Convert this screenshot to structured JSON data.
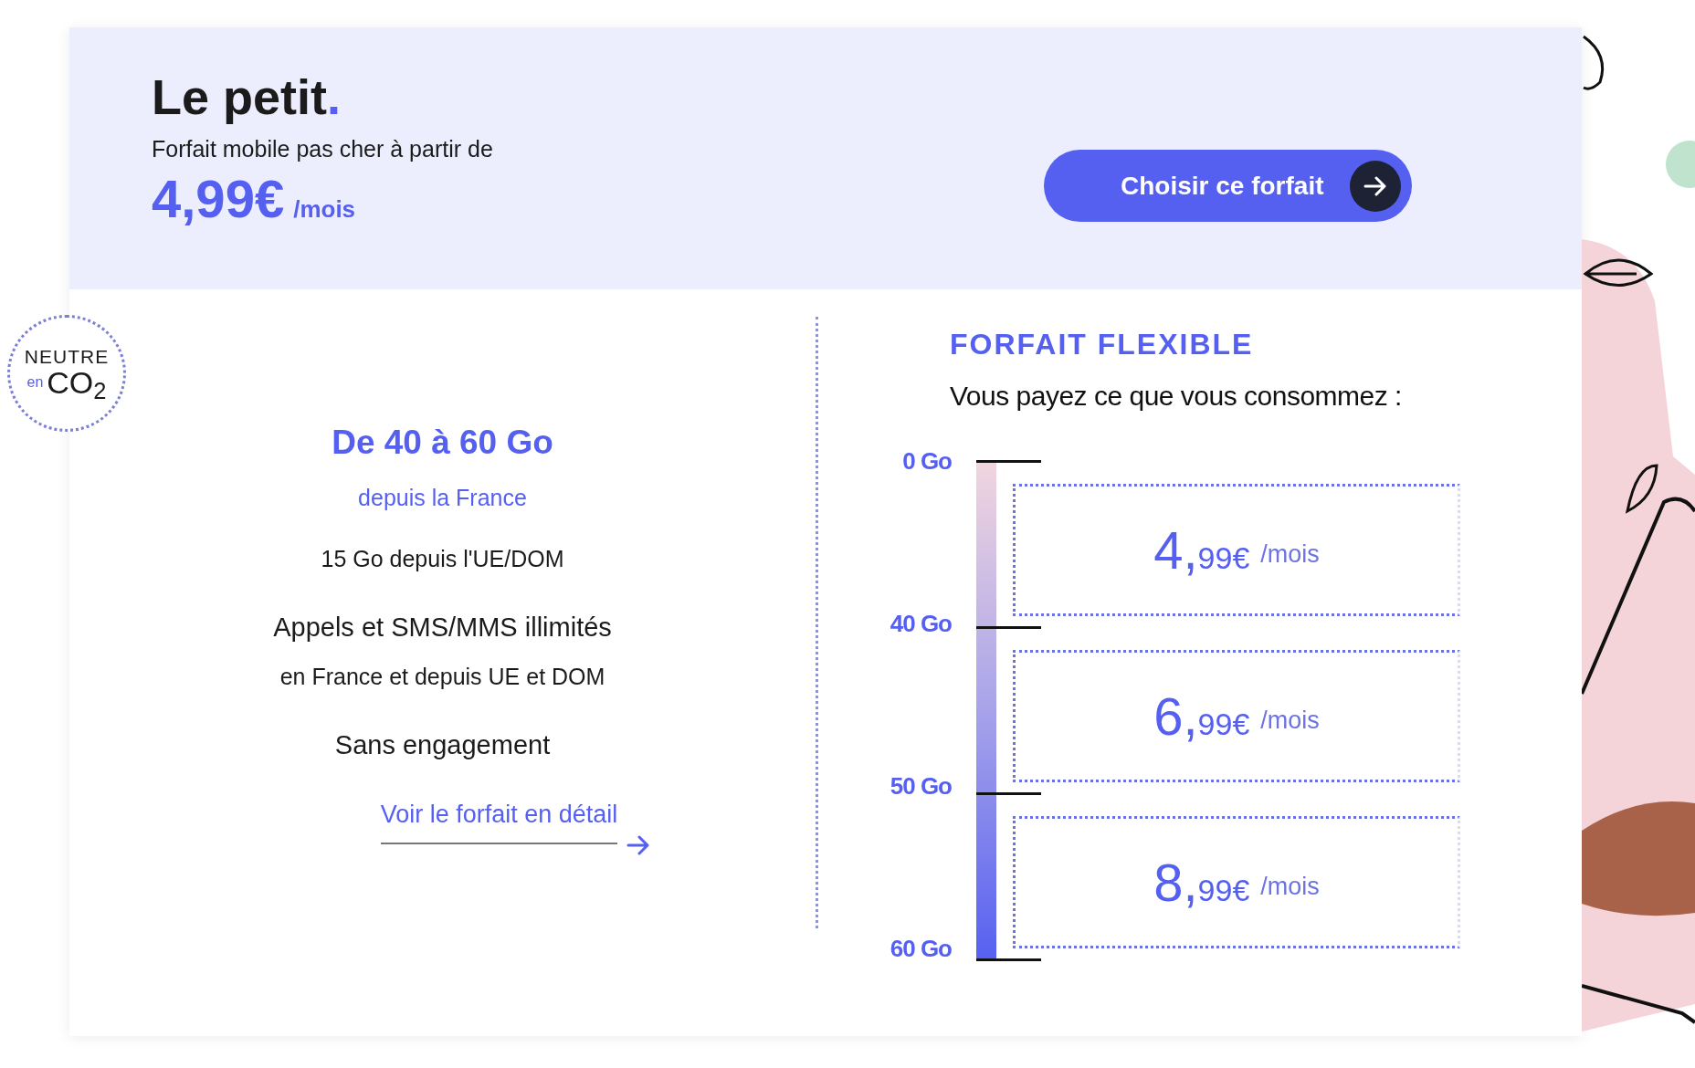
{
  "badge": {
    "line1": "NEUTRE",
    "prefix": "en",
    "formula": "CO$_{2}$"
  },
  "header": {
    "title": "Le petit",
    "title_mark": ".",
    "subtitle": "Forfait mobile pas cher à partir de",
    "price": "4,99€",
    "period": "/mois",
    "button": "Choisir ce forfait"
  },
  "features": [
    {
      "kind": "headline",
      "text": "De 40 à 60 Go"
    },
    {
      "kind": "sub",
      "text": "depuis la France"
    },
    {
      "kind": "plain",
      "text": "15 Go depuis l'UE/DOM"
    },
    {
      "kind": "strong",
      "text": "Appels et SMS/MMS illimités"
    },
    {
      "kind": "plain",
      "text": "en France et depuis UE et DOM"
    },
    {
      "kind": "strong",
      "text": "Sans engagement"
    }
  ],
  "detail_link": "Voir le forfait en détail",
  "flexible": {
    "title": "FORFAIT FLEXIBLE",
    "subtitle": "Vous payez ce que vous consommez :",
    "marks": [
      "0 Go",
      "40 Go",
      "50 Go",
      "60 Go"
    ],
    "tiers": [
      {
        "units": "4,",
        "cents": "99€",
        "period": "/mois"
      },
      {
        "units": "6,",
        "cents": "99€",
        "period": "/mois"
      },
      {
        "units": "8,",
        "cents": "99€",
        "period": "/mois"
      }
    ]
  }
}
